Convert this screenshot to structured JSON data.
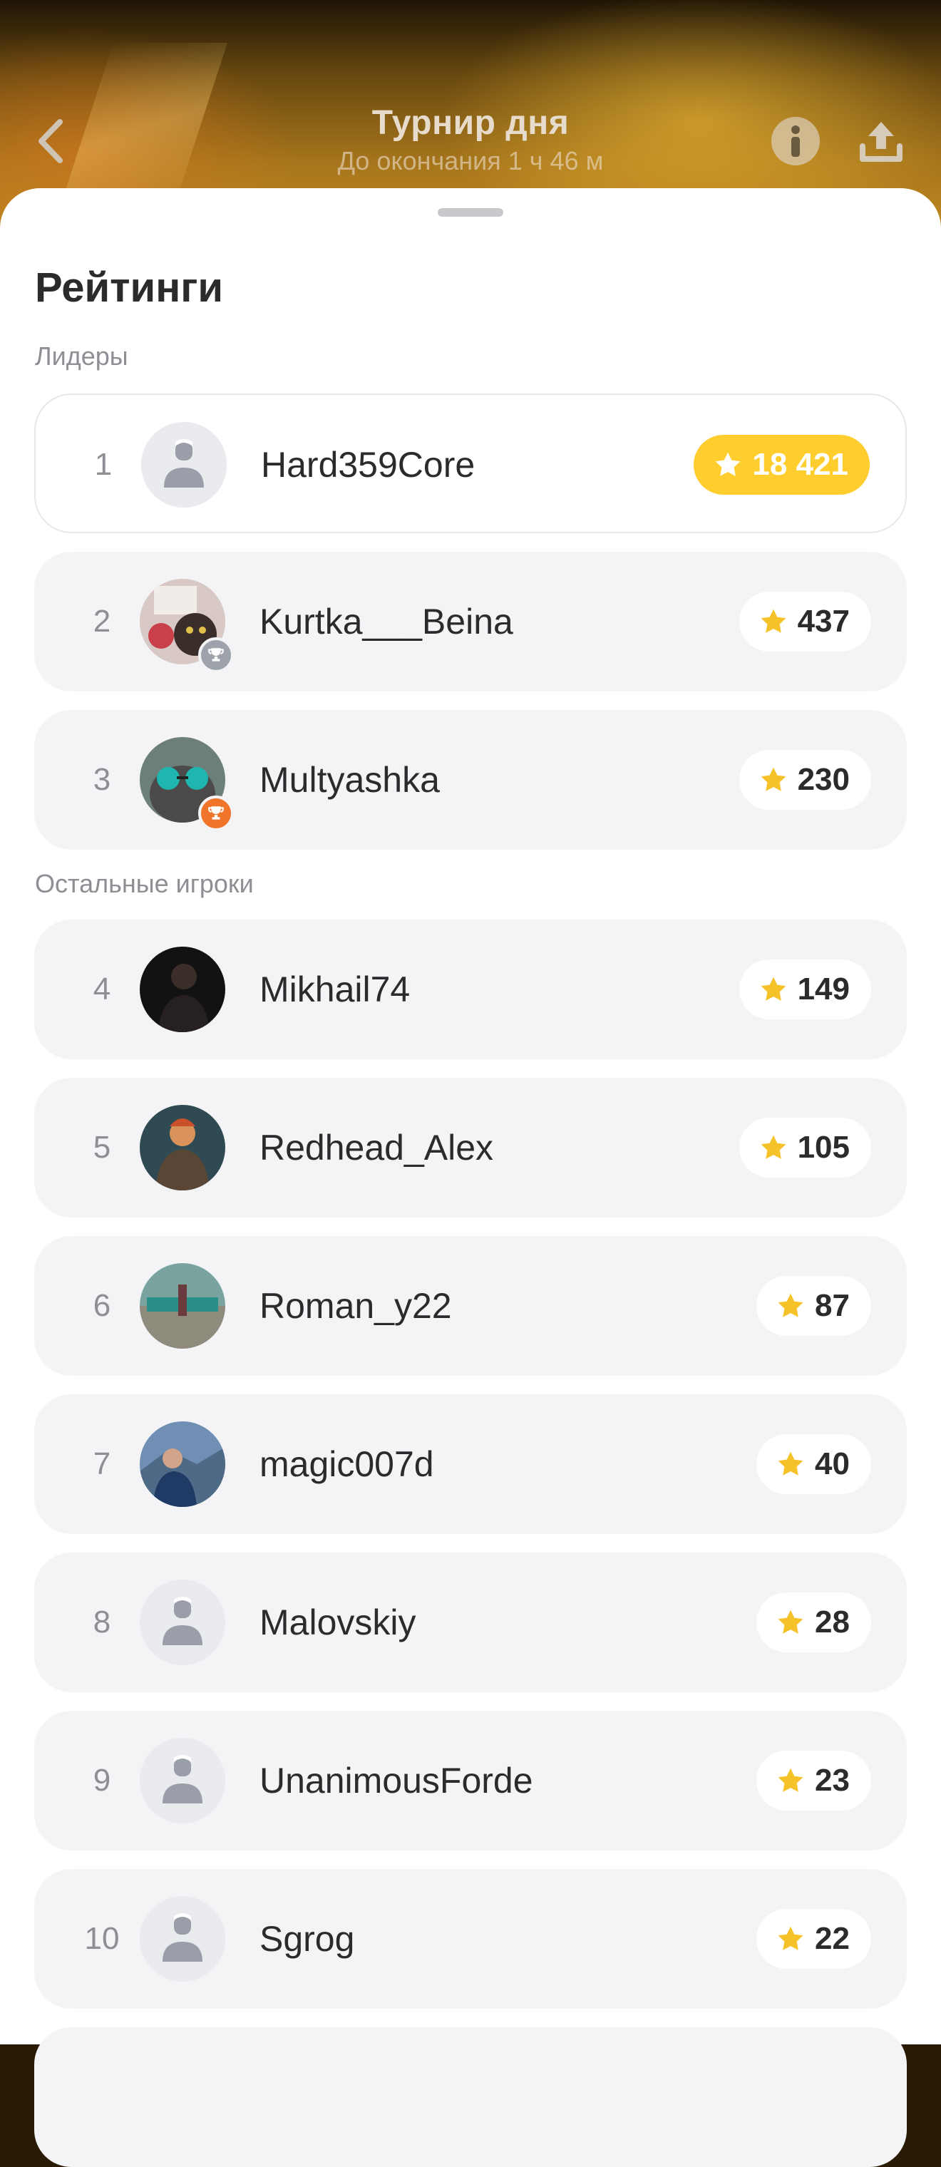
{
  "header": {
    "title": "Турнир дня",
    "subtitle": "До окончания 1 ч 46 м",
    "back_icon": "chevron-left-icon",
    "info_icon": "info-icon",
    "share_icon": "share-icon"
  },
  "colors": {
    "accent_gold": "#ffcd2e",
    "star": "#f6c229",
    "trophy_silver": "#9ea2ab",
    "trophy_bronze": "#f0742a",
    "row_bg": "#f4f4f6"
  },
  "ratings": {
    "title": "Рейтинги",
    "leaders_label": "Лидеры",
    "others_label": "Остальные игроки",
    "rows": [
      {
        "rank": "1",
        "name": "Hard359Core",
        "score": "18 421"
      },
      {
        "rank": "2",
        "name": "Kurtka___Beina",
        "score": "437"
      },
      {
        "rank": "3",
        "name": "Multyashka",
        "score": "230"
      },
      {
        "rank": "4",
        "name": "Mikhail74",
        "score": "149"
      },
      {
        "rank": "5",
        "name": "Redhead_Alex",
        "score": "105"
      },
      {
        "rank": "6",
        "name": "Roman_y22",
        "score": "87"
      },
      {
        "rank": "7",
        "name": "magic007d",
        "score": "40"
      },
      {
        "rank": "8",
        "name": "Malovskiy",
        "score": "28"
      },
      {
        "rank": "9",
        "name": "UnanimousForde",
        "score": "23"
      },
      {
        "rank": "10",
        "name": "Sgrog",
        "score": "22"
      }
    ]
  }
}
